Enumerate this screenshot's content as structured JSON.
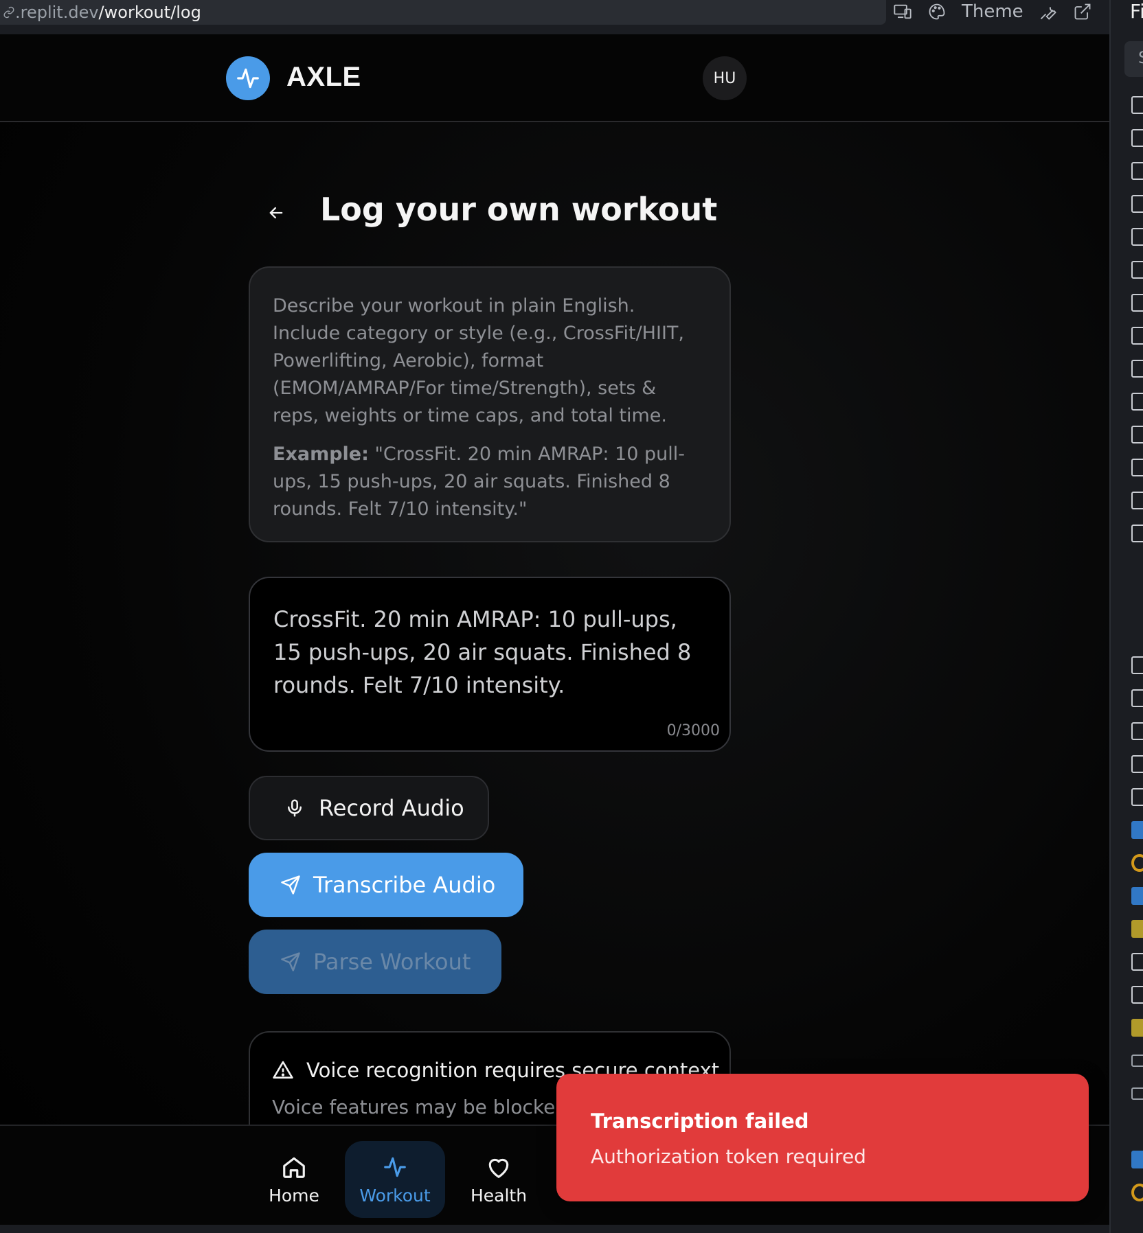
{
  "browser": {
    "url_host": ".replit.dev",
    "url_path": "/workout/log",
    "theme_label": "Theme"
  },
  "header": {
    "brand": "AXLE",
    "avatar_initials": "HU"
  },
  "page": {
    "title": "Log your own workout"
  },
  "instructions": {
    "text": "Describe your workout in plain English. Include category or style (e.g., CrossFit/HIIT, Powerlifting, Aerobic), format (EMOM/AMRAP/For time/Strength), sets & reps, weights or time caps, and total time.",
    "example_label": "Example:",
    "example_text": " \"CrossFit. 20 min AMRAP: 10 pull-ups, 15 push-ups, 20 air squats. Finished 8 rounds. Felt 7/10 intensity.\""
  },
  "workout_input": {
    "placeholder": "CrossFit. 20 min AMRAP: 10 pull-ups, 15 push-ups, 20 air squats. Finished 8 rounds. Felt 7/10 intensity.",
    "char_count": "0/3000"
  },
  "actions": {
    "record_label": "Record Audio",
    "transcribe_label": "Transcribe Audio",
    "parse_label": "Parse Workout"
  },
  "warning": {
    "title": "Voice recognition requires secure context",
    "body": "Voice features may be blocked i"
  },
  "bottom_nav": {
    "items": [
      {
        "label": "Home",
        "icon": "home-icon"
      },
      {
        "label": "Workout",
        "icon": "activity-icon",
        "active": true
      },
      {
        "label": "Health",
        "icon": "heart-icon"
      }
    ]
  },
  "toast": {
    "title": "Transcription failed",
    "message": "Authorization token required",
    "color": "#e13b3b"
  },
  "side_panel": {
    "title": "Fi",
    "search_placeholder": "S"
  },
  "colors": {
    "accent": "#4a9be8",
    "background": "#000000",
    "error": "#e13b3b"
  }
}
